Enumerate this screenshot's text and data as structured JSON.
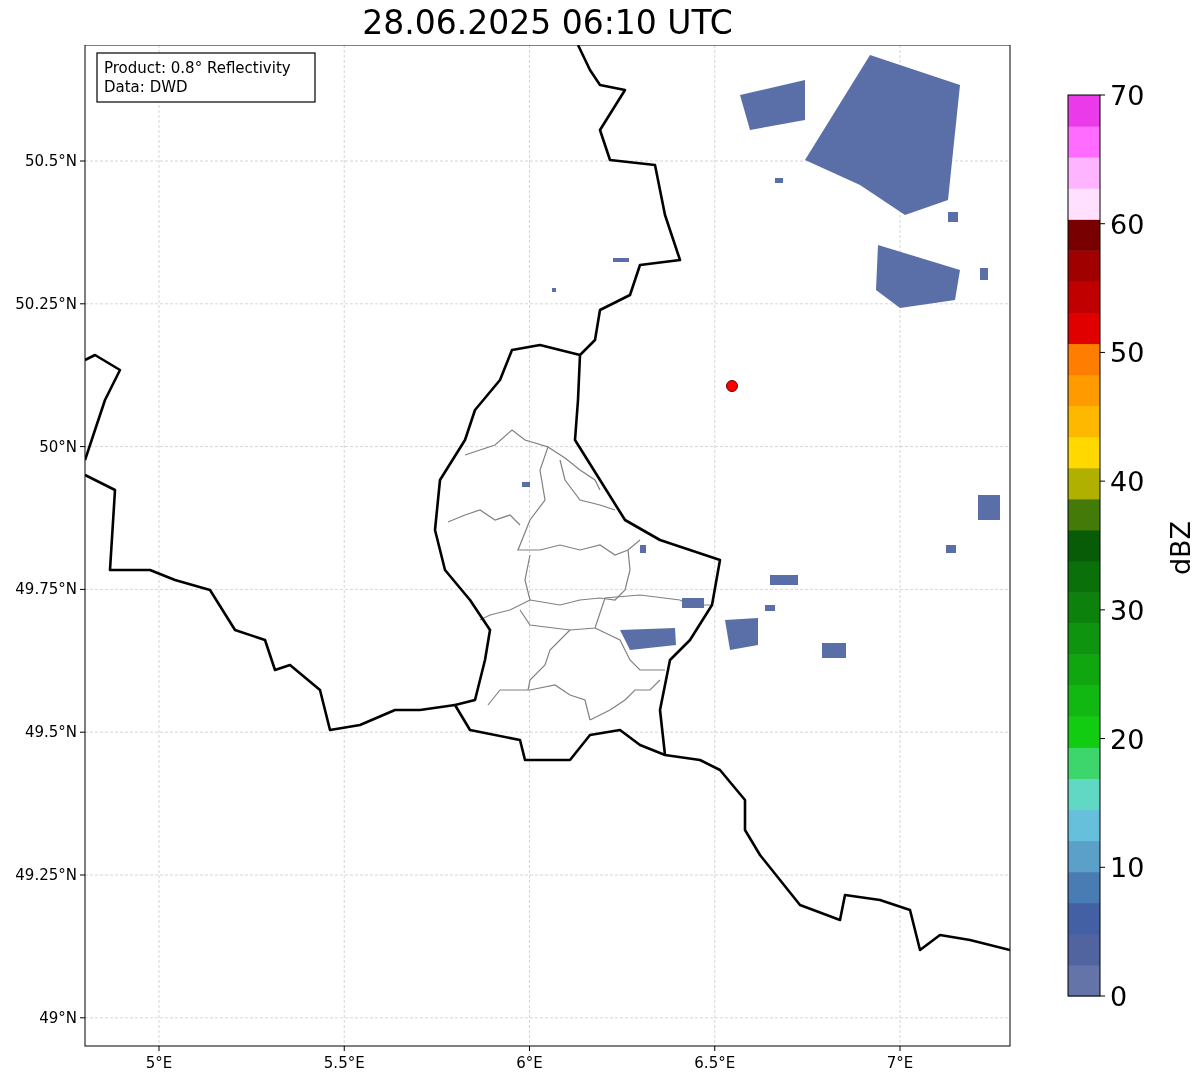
{
  "title": "28.06.2025 06:10 UTC",
  "annotation": {
    "lines": [
      "Product: 0.8° Reflectivity",
      "Data: DWD"
    ]
  },
  "map": {
    "x_ticks": [
      "5°E",
      "5.5°E",
      "6°E",
      "6.5°E",
      "7°E"
    ],
    "y_ticks": [
      "50.5°N",
      "50.25°N",
      "50°N",
      "49.75°N",
      "49.5°N",
      "49.25°N",
      "49°N"
    ]
  },
  "colorbar": {
    "label": "dBZ",
    "ticks": [
      "70",
      "60",
      "50",
      "40",
      "30",
      "20",
      "10",
      "0"
    ],
    "segments": [
      {
        "color": "#6474a8"
      },
      {
        "color": "#5264a0"
      },
      {
        "color": "#4460a4"
      },
      {
        "color": "#4a7cb4"
      },
      {
        "color": "#5aa0c8"
      },
      {
        "color": "#66c0dc"
      },
      {
        "color": "#60d8c4"
      },
      {
        "color": "#3cd66c"
      },
      {
        "color": "#12cc12"
      },
      {
        "color": "#12b812"
      },
      {
        "color": "#10a610"
      },
      {
        "color": "#0e940e"
      },
      {
        "color": "#0c820c"
      },
      {
        "color": "#0a700a"
      },
      {
        "color": "#085c08"
      },
      {
        "color": "#447a08"
      },
      {
        "color": "#b0b000"
      },
      {
        "color": "#ffd800"
      },
      {
        "color": "#ffb800"
      },
      {
        "color": "#ff9a00"
      },
      {
        "color": "#ff7d00"
      },
      {
        "color": "#e00000"
      },
      {
        "color": "#c00000"
      },
      {
        "color": "#a00000"
      },
      {
        "color": "#780000"
      },
      {
        "color": "#ffe0ff"
      },
      {
        "color": "#ffb4ff"
      },
      {
        "color": "#ff6cff"
      },
      {
        "color": "#ea3aea"
      }
    ]
  }
}
